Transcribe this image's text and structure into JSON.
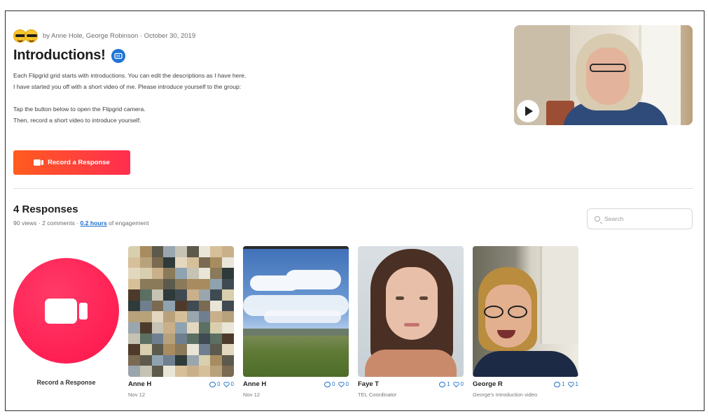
{
  "header": {
    "meta": "by Anne Hole, George Robinson · October 30, 2019",
    "title": "Introductions!",
    "description": [
      "Each Flipgrid grid starts with introductions. You can edit the descriptions as I have here.",
      "I have started you off with a short video of me. Please introduce yourself to the group:",
      "",
      "Tap the button below to open the Flipgrid camera.",
      "Then, record a short video to introduce yourself."
    ],
    "record_button": "Record a Response"
  },
  "responses": {
    "title": "4 Responses",
    "stats_prefix": "90 views · 2 comments · ",
    "hours": "0.2 hours",
    "stats_suffix": " of engagement",
    "search_placeholder": "Search",
    "record_label": "Record a Response",
    "cards": [
      {
        "name": "Anne H",
        "subtitle": "Nov 12",
        "comments": "0",
        "likes": "0"
      },
      {
        "name": "Anne H",
        "subtitle": "Nov 12",
        "comments": "0",
        "likes": "0"
      },
      {
        "name": "Faye T",
        "subtitle": "TEL Coordinator",
        "comments": "1",
        "likes": "0"
      },
      {
        "name": "George R",
        "subtitle": "George's introduction video",
        "comments": "1",
        "likes": "1"
      }
    ]
  },
  "colors": {
    "accent_blue": "#1b6fc8",
    "record_gradient_start": "#ff5c1f",
    "record_gradient_end": "#ff2d4f",
    "record_circle": "#ff1f53"
  },
  "icons": [
    "sunglasses-emoji-icon",
    "closed-caption-icon",
    "video-camera-icon",
    "play-icon",
    "search-icon",
    "comment-icon",
    "heart-icon"
  ]
}
